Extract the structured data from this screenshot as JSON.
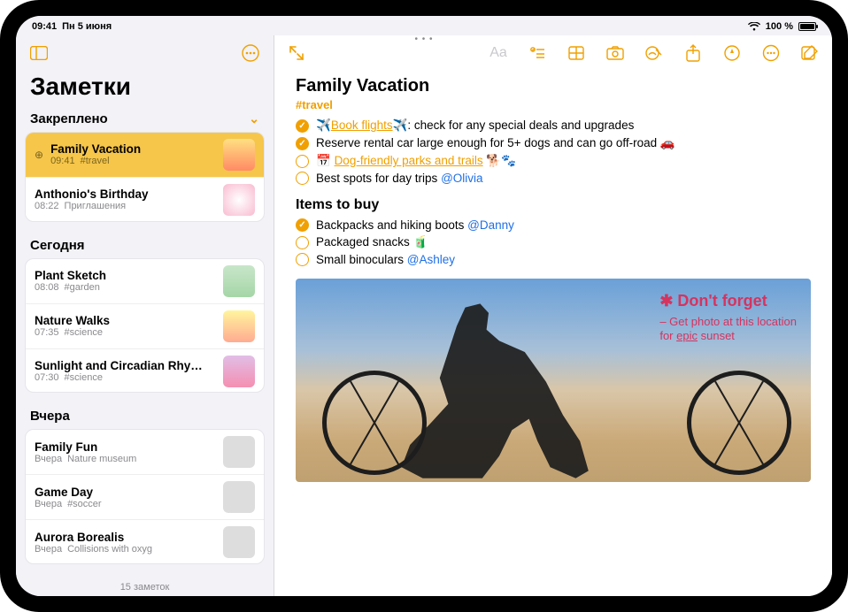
{
  "status": {
    "time": "09:41",
    "date": "Пн 5 июня",
    "wifi": "wifi",
    "battery": "100 %"
  },
  "sidebar": {
    "title": "Заметки",
    "pinned_label": "Закреплено",
    "today_label": "Сегодня",
    "yesterday_label": "Вчера",
    "footer": "15 заметок",
    "pinned": [
      {
        "title": "Family Vacation",
        "time": "09:41",
        "tag": "#travel"
      },
      {
        "title": "Anthonio's Birthday",
        "time": "08:22",
        "tag": "Приглашения"
      }
    ],
    "today": [
      {
        "title": "Plant Sketch",
        "time": "08:08",
        "tag": "#garden"
      },
      {
        "title": "Nature Walks",
        "time": "07:35",
        "tag": "#science"
      },
      {
        "title": "Sunlight and Circadian Rhy…",
        "time": "07:30",
        "tag": "#science"
      }
    ],
    "yesterday": [
      {
        "title": "Family Fun",
        "time": "Вчера",
        "tag": "Nature museum"
      },
      {
        "title": "Game Day",
        "time": "Вчера",
        "tag": "#soccer"
      },
      {
        "title": "Aurora Borealis",
        "time": "Вчера",
        "tag": "Collisions with oxyg"
      }
    ]
  },
  "note": {
    "title": "Family Vacation",
    "tag": "#travel",
    "items": [
      {
        "done": true,
        "pre": "✈️",
        "link": "Book flights",
        "post": "✈️: check for any special deals and upgrades"
      },
      {
        "done": true,
        "text": "Reserve rental car large enough for 5+ dogs and can go off-road 🚗"
      },
      {
        "done": false,
        "pre": "📅 ",
        "link": "Dog-friendly parks and trails",
        "post": " 🐕🐾"
      },
      {
        "done": false,
        "text": "Best spots for day trips ",
        "mention": "@Olivia"
      }
    ],
    "sub": "Items to buy",
    "buy": [
      {
        "done": true,
        "text": "Backpacks and hiking boots ",
        "mention": "@Danny"
      },
      {
        "done": false,
        "text": "Packaged snacks 🧃"
      },
      {
        "done": false,
        "text": "Small binoculars ",
        "mention": "@Ashley"
      }
    ],
    "annot_main": "✱ Don't forget",
    "annot_sub_a": "– Get photo at this location",
    "annot_sub_b": "for epic sunset"
  }
}
